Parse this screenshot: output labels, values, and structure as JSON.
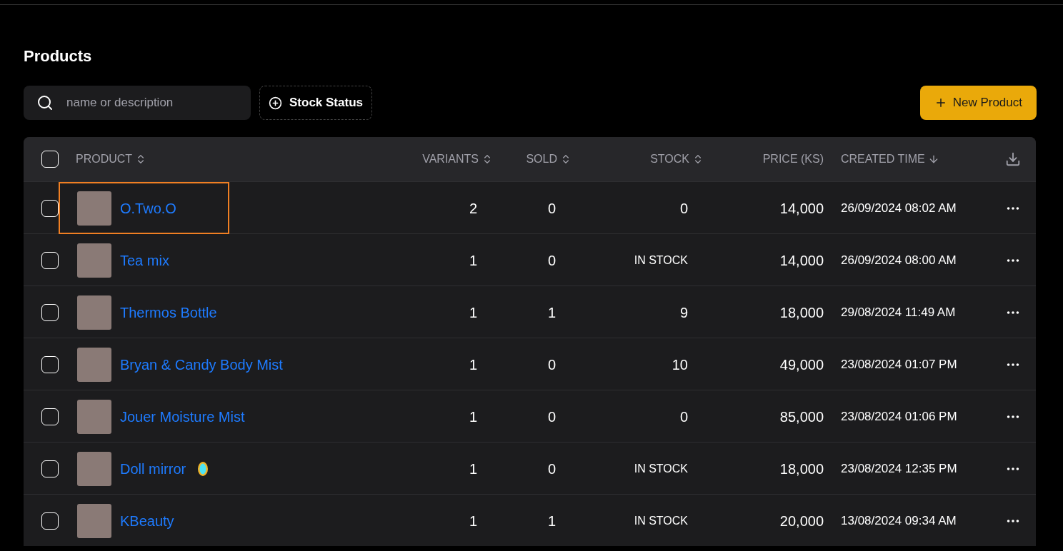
{
  "page": {
    "title": "Products"
  },
  "toolbar": {
    "search": {
      "placeholder": "name or description"
    },
    "filter": {
      "label": "Stock Status"
    },
    "new_button": {
      "label": "New Product"
    }
  },
  "table": {
    "select_all_checked": false,
    "columns": [
      {
        "label": "PRODUCT",
        "sortable": true,
        "sorted": false
      },
      {
        "label": "VARIANTS",
        "sortable": true,
        "sorted": false
      },
      {
        "label": "SOLD",
        "sortable": true,
        "sorted": false
      },
      {
        "label": "STOCK",
        "sortable": true,
        "sorted": false
      },
      {
        "label": "PRICE (KS)",
        "sortable": false,
        "sorted": false
      },
      {
        "label": "CREATED TIME",
        "sortable": true,
        "sorted": true
      }
    ],
    "rows": [
      {
        "checked": false,
        "highlighted": true,
        "name": "O.Two.O",
        "emoji_icon": false,
        "variants": "2",
        "sold": "0",
        "stock": {
          "kind": "count",
          "text": "0"
        },
        "price": "14,000",
        "created": "26/09/2024 08:02 AM"
      },
      {
        "checked": false,
        "highlighted": false,
        "name": "Tea mix",
        "emoji_icon": false,
        "variants": "1",
        "sold": "0",
        "stock": {
          "kind": "label",
          "text": "IN STOCK"
        },
        "price": "14,000",
        "created": "26/09/2024 08:00 AM"
      },
      {
        "checked": false,
        "highlighted": false,
        "name": "Thermos Bottle",
        "emoji_icon": false,
        "variants": "1",
        "sold": "1",
        "stock": {
          "kind": "count",
          "text": "9"
        },
        "price": "18,000",
        "created": "29/08/2024 11:49 AM"
      },
      {
        "checked": false,
        "highlighted": false,
        "name": "Bryan & Candy Body Mist",
        "emoji_icon": false,
        "variants": "1",
        "sold": "0",
        "stock": {
          "kind": "count",
          "text": "10"
        },
        "price": "49,000",
        "created": "23/08/2024 01:07 PM"
      },
      {
        "checked": false,
        "highlighted": false,
        "name": "Jouer Moisture Mist",
        "emoji_icon": false,
        "variants": "1",
        "sold": "0",
        "stock": {
          "kind": "count",
          "text": "0"
        },
        "price": "85,000",
        "created": "23/08/2024 01:06 PM"
      },
      {
        "checked": false,
        "highlighted": false,
        "name": "Doll mirror",
        "emoji_icon": true,
        "variants": "1",
        "sold": "0",
        "stock": {
          "kind": "label",
          "text": "IN STOCK"
        },
        "price": "18,000",
        "created": "23/08/2024 12:35 PM"
      },
      {
        "checked": false,
        "highlighted": false,
        "name": "KBeauty",
        "emoji_icon": false,
        "variants": "1",
        "sold": "1",
        "stock": {
          "kind": "label",
          "text": "IN STOCK"
        },
        "price": "20,000",
        "created": "13/08/2024 09:34 AM"
      }
    ]
  }
}
